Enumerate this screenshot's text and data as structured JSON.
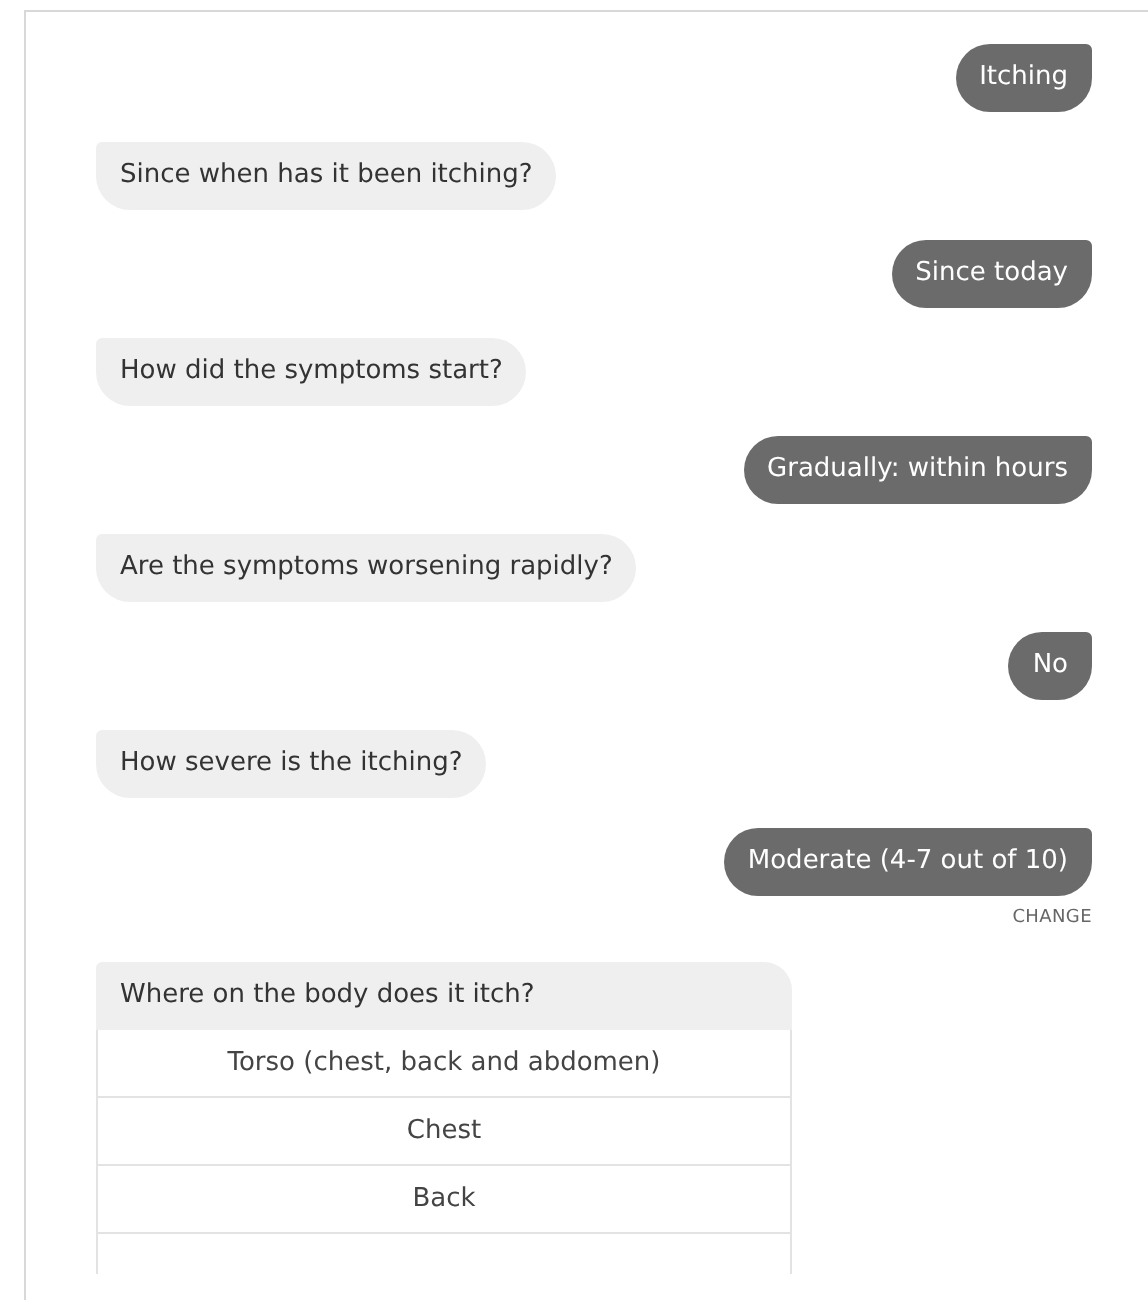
{
  "messages": [
    {
      "kind": "user",
      "text": "Itching"
    },
    {
      "kind": "bot",
      "text": "Since when has it been itching?"
    },
    {
      "kind": "user",
      "text": "Since today"
    },
    {
      "kind": "bot",
      "text": "How did the symptoms start?"
    },
    {
      "kind": "user",
      "text": "Gradually: within hours"
    },
    {
      "kind": "bot",
      "text": "Are the symptoms worsening rapidly?"
    },
    {
      "kind": "user",
      "text": "No"
    },
    {
      "kind": "bot",
      "text": "How severe is the itching?"
    },
    {
      "kind": "user",
      "text": "Moderate (4-7 out of 10)",
      "action": "CHANGE"
    }
  ],
  "question": {
    "text": "Where on the body does it itch?",
    "options": [
      "Torso (chest, back and abdomen)",
      "Chest",
      "Back"
    ]
  }
}
